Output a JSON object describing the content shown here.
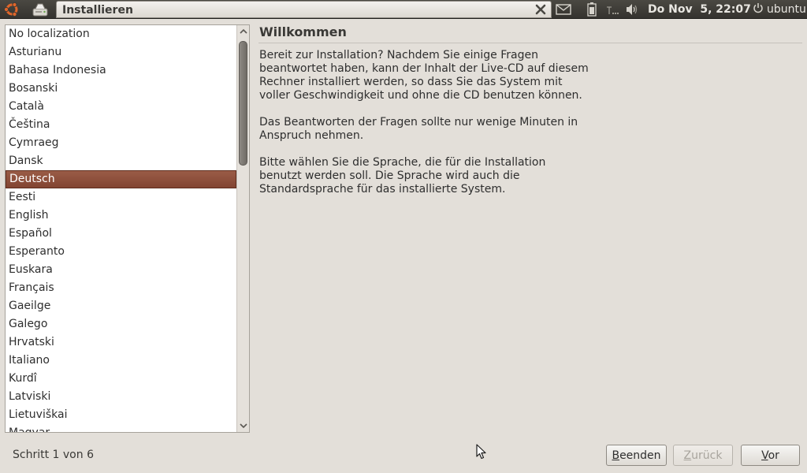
{
  "panel": {
    "window_title": "Installieren",
    "clock": "Do Nov  5, 22:07",
    "user": "ubuntu",
    "icons": [
      "ubuntu-logo-icon",
      "installer-launcher-icon",
      "close-icon",
      "mail-icon",
      "battery-icon",
      "network-icon",
      "volume-icon",
      "power-icon"
    ]
  },
  "languages": {
    "items": [
      "No localization",
      "Asturianu",
      "Bahasa Indonesia",
      "Bosanski",
      "Català",
      "Čeština",
      "Cymraeg",
      "Dansk",
      "Deutsch",
      "Eesti",
      "English",
      "Español",
      "Esperanto",
      "Euskara",
      "Français",
      "Gaeilge",
      "Galego",
      "Hrvatski",
      "Italiano",
      "Kurdî",
      "Latviski",
      "Lietuviškai",
      "Magyar"
    ],
    "selected": "Deutsch"
  },
  "content": {
    "title": "Willkommen",
    "paragraph1": "Bereit zur Installation? Nachdem Sie einige Fragen beantwortet haben, kann der Inhalt der Live-CD auf diesem Rechner installiert werden, so dass Sie das System mit voller Geschwindigkeit und ohne die CD benutzen können.",
    "paragraph2": "Das Beantworten der Fragen sollte nur wenige Minuten in Anspruch nehmen.",
    "paragraph3": "Bitte wählen Sie die Sprache, die für die Installation benutzt werden soll. Die Sprache wird auch die Standardsprache für das installierte System."
  },
  "footer": {
    "step": "Schritt 1 von 6",
    "quit_label": "Beenden",
    "back_label": "Zurück",
    "forward_label": "Vor"
  },
  "colors": {
    "selection": "#8a4b38",
    "window_bg": "#e3dfd9",
    "panel_bg": "#3d3b37"
  }
}
